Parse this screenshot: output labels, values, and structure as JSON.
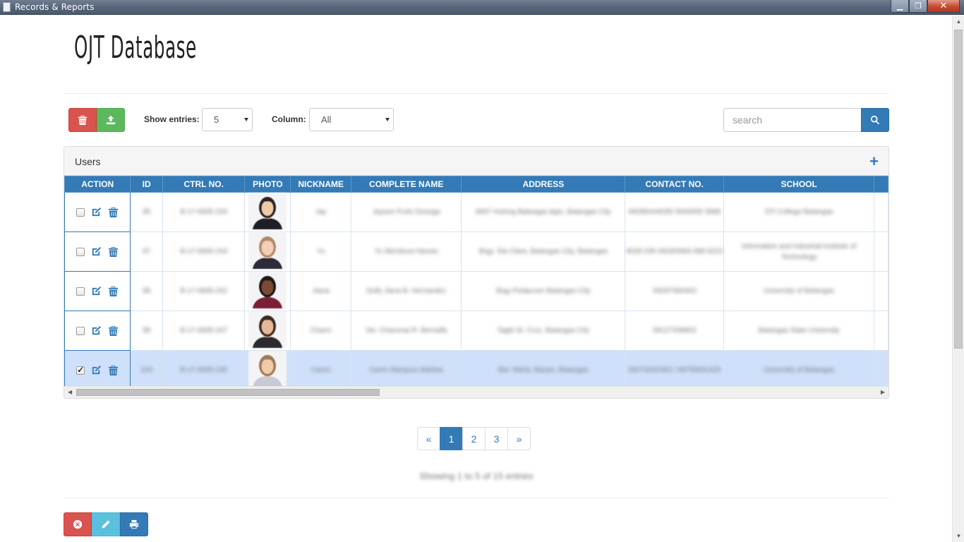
{
  "window": {
    "title": "Records & Reports"
  },
  "page": {
    "title": "OJT Database"
  },
  "toolbar": {
    "show_entries_label": "Show entries:",
    "show_entries_value": "5",
    "column_label": "Column:",
    "column_value": "All",
    "search_placeholder": "search"
  },
  "panel": {
    "title": "Users"
  },
  "table": {
    "headers": [
      "ACTION",
      "ID",
      "CTRL NO.",
      "PHOTO",
      "NICKNAME",
      "COMPLETE NAME",
      "ADDRESS",
      "CONTACT NO.",
      "SCHOOL"
    ],
    "rows": [
      {
        "checked": false,
        "selected": false,
        "id": "95",
        "ctrl": "B-17-0835-234",
        "nickname": "Jay",
        "name": "Jaysen Purlo Donega",
        "address": "8007 Hulong Batangas Ajan, Batangas City",
        "contact": "09285444035/ 0043055 3968",
        "school": "STI College Batangas"
      },
      {
        "checked": false,
        "selected": false,
        "id": "97",
        "ctrl": "B-17-0835-243",
        "nickname": "Yu",
        "name": "Yu Mendoza Hamas",
        "address": "Brgy. Sta Clara, Batangas City, Batangas",
        "contact": "9028 039 0933/0993-388 8223",
        "school": "Information and Industrial Institute of Technology"
      },
      {
        "checked": false,
        "selected": false,
        "id": "98",
        "ctrl": "B-17-0835-242",
        "nickname": "Jiana",
        "name": "Dolly Jiana B. Hernandez",
        "address": "Brgy Pedacoon Batangas City",
        "contact": "09287580463",
        "school": "University of Batangas"
      },
      {
        "checked": false,
        "selected": false,
        "id": "99",
        "ctrl": "B-17-0835-247",
        "nickname": "Charm",
        "name": "Ver. Charzmai R. Bernalfa",
        "address": "Tagbi St. Cruz, Batangas City",
        "contact": "09127208903",
        "school": "Batangas State University"
      },
      {
        "checked": true,
        "selected": true,
        "id": "104",
        "ctrl": "B-17-0835-245",
        "nickname": "Caren",
        "name": "Caren Marquez Alarkas",
        "address": "Bar. Maria, Bauan, Batangas",
        "contact": "09275442363 / 09755831420",
        "school": "University of Batangas"
      }
    ]
  },
  "pagination": {
    "prev": "«",
    "pages": [
      "1",
      "2",
      "3"
    ],
    "active": "1",
    "next": "»"
  },
  "info_text": "Showing 1 to 5 of 15 entries",
  "colors": {
    "primary": "#337ab7",
    "danger": "#d9534f",
    "success": "#5cb85c",
    "info": "#5bc0de",
    "selected_row": "#cfe0fa"
  }
}
